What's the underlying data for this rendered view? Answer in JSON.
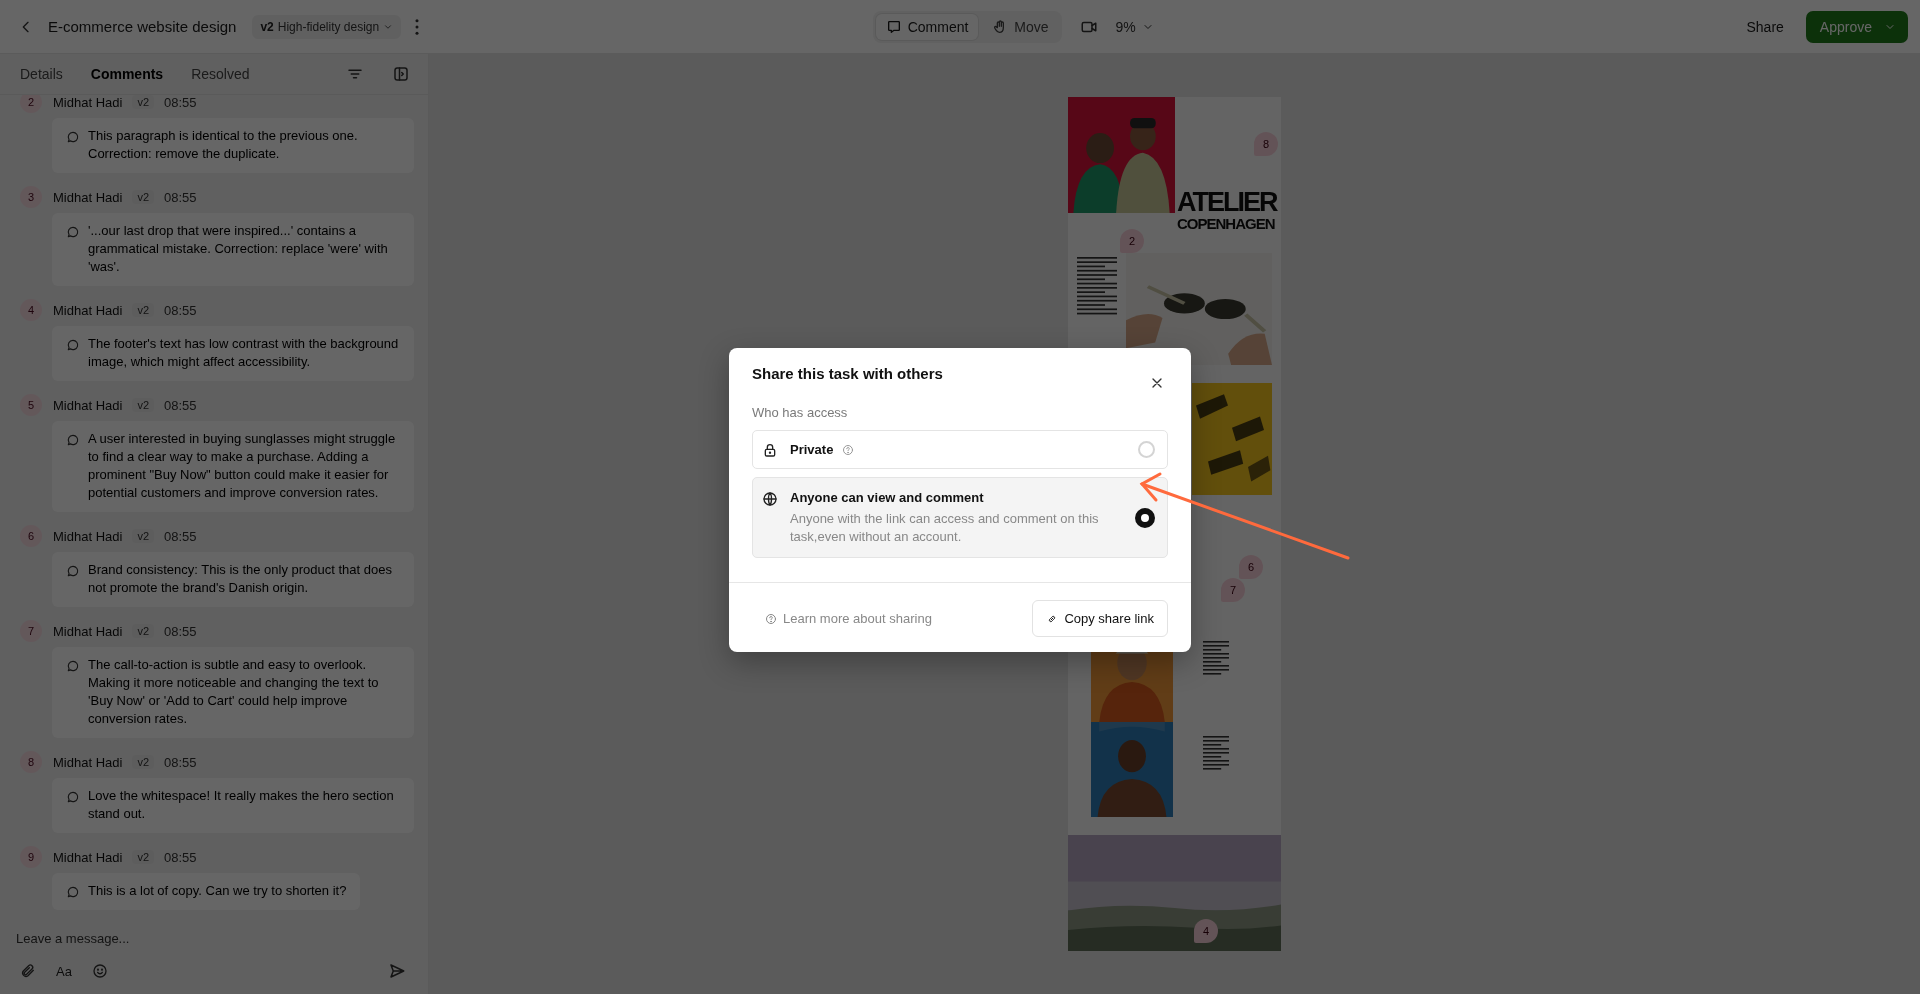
{
  "top_bar": {
    "title": "E-commerce website design",
    "version": {
      "tag": "v2",
      "label": "High-fidelity design"
    },
    "modes": [
      {
        "kind": "comment",
        "label": "Comment",
        "selected": true
      },
      {
        "kind": "move",
        "label": "Move",
        "selected": false
      }
    ],
    "zoom": "9%",
    "share": "Share",
    "approve": "Approve"
  },
  "panel": {
    "tabs": [
      {
        "label": "Details",
        "selected": false
      },
      {
        "label": "Comments",
        "selected": true
      },
      {
        "label": "Resolved",
        "selected": false
      }
    ],
    "comments": [
      {
        "number": "2",
        "author": "Midhat Hadi",
        "version": "v2",
        "time": "08:55",
        "text": "This paragraph is identical to the previous one. Correction: remove the duplicate."
      },
      {
        "number": "3",
        "author": "Midhat Hadi",
        "version": "v2",
        "time": "08:55",
        "text": "'...our last drop that were inspired...' contains a grammatical mistake. Correction: replace 'were' with 'was'."
      },
      {
        "number": "4",
        "author": "Midhat Hadi",
        "version": "v2",
        "time": "08:55",
        "text": "The footer's text has low contrast with the background image, which might affect accessibility."
      },
      {
        "number": "5",
        "author": "Midhat Hadi",
        "version": "v2",
        "time": "08:55",
        "text": "A user interested in buying sunglasses might struggle to find a clear way to make a purchase. Adding a prominent \"Buy Now\" button could make it easier for potential customers and improve conversion rates."
      },
      {
        "number": "6",
        "author": "Midhat Hadi",
        "version": "v2",
        "time": "08:55",
        "text": "Brand consistency: This is the only product that does not promote the brand's Danish origin."
      },
      {
        "number": "7",
        "author": "Midhat Hadi",
        "version": "v2",
        "time": "08:55",
        "text": "The call-to-action is subtle and easy to overlook. Making it more noticeable and changing the text to 'Buy Now' or 'Add to Cart' could help improve conversion rates."
      },
      {
        "number": "8",
        "author": "Midhat Hadi",
        "version": "v2",
        "time": "08:55",
        "text": "Love the whitespace! It really makes the hero section stand out."
      },
      {
        "number": "9",
        "author": "Midhat Hadi",
        "version": "v2",
        "time": "08:55",
        "text": "This is a lot of copy. Can we try to shorten it?"
      }
    ],
    "composer": {
      "placeholder": "Leave a message...",
      "format_label": "Aa"
    }
  },
  "preview": {
    "brand": [
      "ATELIER",
      "COPENHAGEN"
    ],
    "pins": [
      {
        "number": "8"
      },
      {
        "number": "2"
      },
      {
        "number": "6"
      },
      {
        "number": "7"
      },
      {
        "number": "4"
      }
    ]
  },
  "dialog": {
    "title": "Share this task with others",
    "section": "Who has access",
    "options": [
      {
        "kind": "lock",
        "title": "Private",
        "help": true,
        "selected": false
      },
      {
        "kind": "globe",
        "title": "Anyone can view and comment",
        "description": "Anyone with the link can access and comment on this task,even without an account.",
        "help": false,
        "selected": true
      }
    ],
    "learn_more": "Learn more about sharing",
    "copy_link": "Copy share link"
  }
}
